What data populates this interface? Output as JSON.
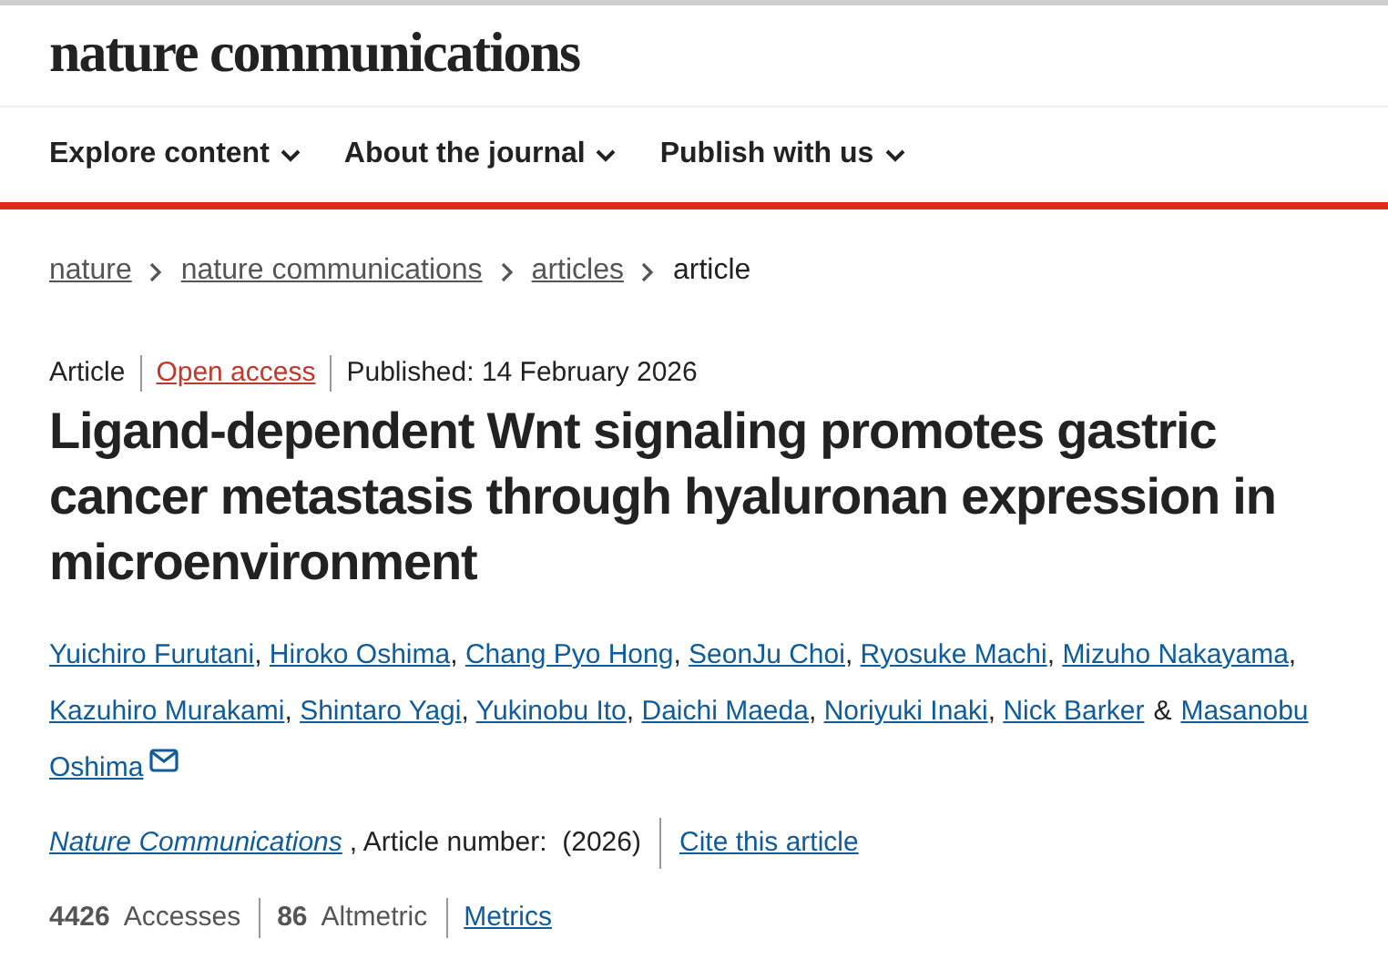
{
  "header": {
    "logo": "nature communications",
    "nav": [
      {
        "label": "Explore content"
      },
      {
        "label": "About the journal"
      },
      {
        "label": "Publish with us"
      }
    ]
  },
  "breadcrumbs": [
    {
      "label": "nature",
      "link": true
    },
    {
      "label": "nature communications",
      "link": true
    },
    {
      "label": "articles",
      "link": true
    },
    {
      "label": "article",
      "link": false
    }
  ],
  "meta": {
    "type": "Article",
    "access": "Open access",
    "published": "Published: 14 February 2026"
  },
  "title": "Ligand-dependent Wnt signaling promotes gastric cancer metastasis through hyaluronan expression in microenvironment",
  "authors": [
    {
      "name": "Yuichiro Furutani",
      "after": ",",
      "email": false
    },
    {
      "name": "Hiroko Oshima",
      "after": ",",
      "email": false
    },
    {
      "name": "Chang Pyo Hong",
      "after": ",",
      "email": false
    },
    {
      "name": "SeonJu Choi",
      "after": ",",
      "email": false
    },
    {
      "name": "Ryosuke Machi",
      "after": ",",
      "email": false
    },
    {
      "name": "Mizuho Nakayama",
      "after": ",",
      "email": false
    },
    {
      "name": "Kazuhiro Murakami",
      "after": ",",
      "email": false
    },
    {
      "name": "Shintaro Yagi",
      "after": ",",
      "email": false
    },
    {
      "name": "Yukinobu Ito",
      "after": ",",
      "email": false
    },
    {
      "name": "Daichi Maeda",
      "after": ",",
      "email": false
    },
    {
      "name": "Noriyuki Inaki",
      "after": ",",
      "email": false
    },
    {
      "name": "Nick Barker",
      "after": "&",
      "email": false
    },
    {
      "name": "Masanobu Oshima",
      "email": true,
      "name_wraps": true
    }
  ],
  "citation": {
    "journal": "Nature Communications",
    "article_number": ", Article number:  (2026)",
    "cite": "Cite this article"
  },
  "metrics": [
    {
      "text": "**4426**  Accesses",
      "kind": "stat"
    },
    {
      "text": "**86**  Altmetric",
      "kind": "stat"
    },
    {
      "text": "Metrics",
      "kind": "link"
    }
  ]
}
